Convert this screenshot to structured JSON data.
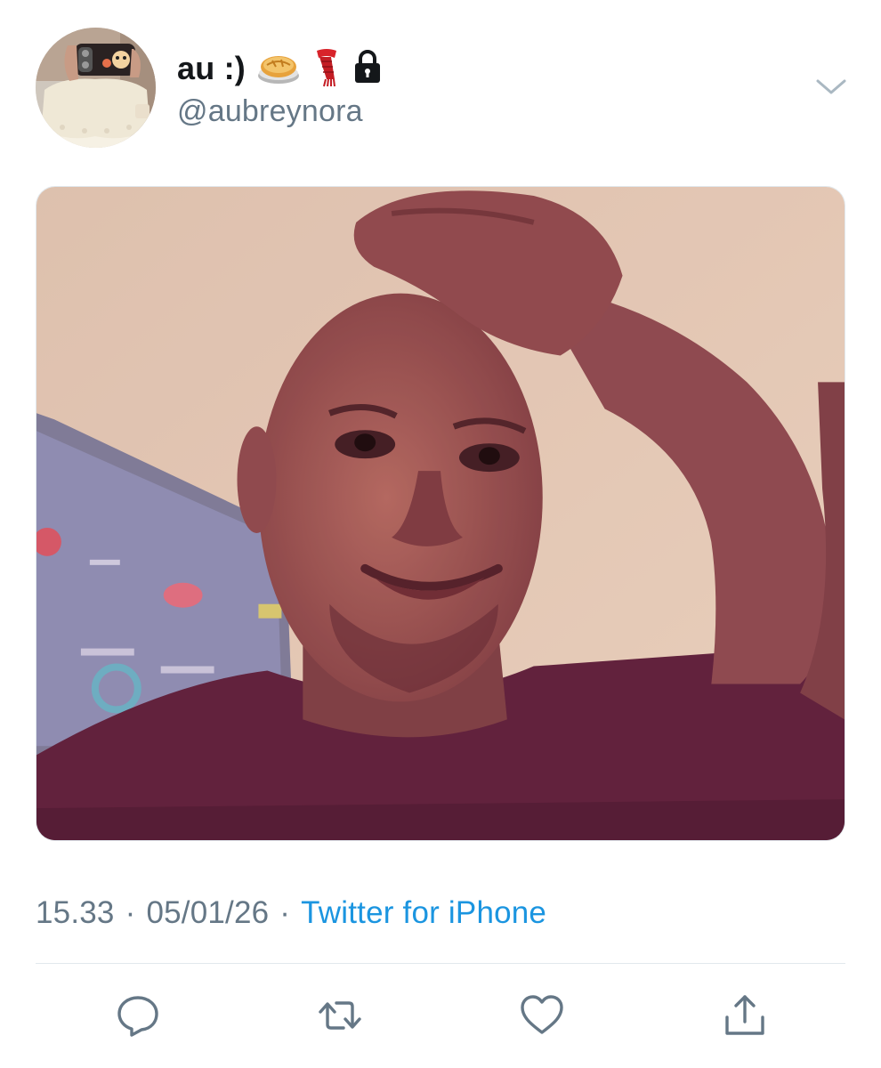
{
  "user": {
    "display_name": "au :)",
    "badges": [
      "pie-icon",
      "scarf-icon",
      "lock-icon"
    ],
    "handle": "@aubreynora"
  },
  "media": {
    "type": "photo",
    "description_icon": "selfie-photo"
  },
  "meta": {
    "time": "15.33",
    "separator": "·",
    "date": "05/01/26",
    "source": "Twitter for iPhone"
  },
  "actions": [
    "reply-icon",
    "retweet-icon",
    "like-icon",
    "share-icon"
  ],
  "colors": {
    "text_primary": "#14171a",
    "text_secondary": "#657786",
    "link": "#1b95e0",
    "divider": "#e1e8ed",
    "icon": "#657786"
  }
}
